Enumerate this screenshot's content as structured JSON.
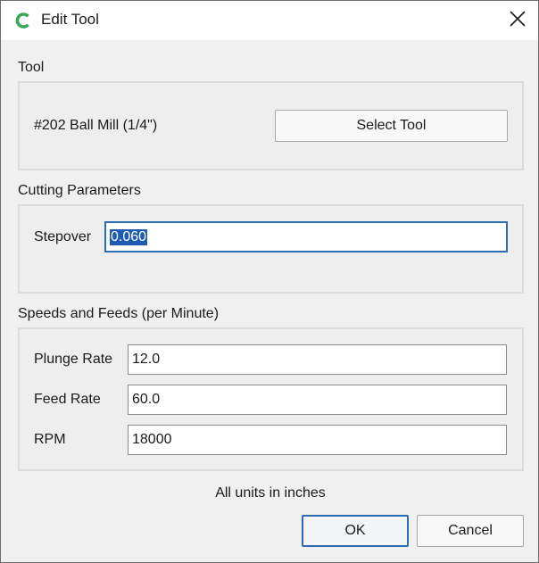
{
  "window": {
    "title": "Edit Tool",
    "app_icon": "green-c-logo-icon",
    "close_icon": "close-x-icon"
  },
  "tool_section": {
    "label": "Tool",
    "tool_name": "#202 Ball Mill (1/4\")",
    "select_button": "Select Tool"
  },
  "cutting_section": {
    "label": "Cutting Parameters",
    "stepover_label": "Stepover",
    "stepover_value": "0.060"
  },
  "speeds_section": {
    "label": "Speeds and Feeds (per Minute)",
    "plunge_label": "Plunge Rate",
    "plunge_value": "12.0",
    "feed_label": "Feed Rate",
    "feed_value": "60.0",
    "rpm_label": "RPM",
    "rpm_value": "18000"
  },
  "footer": {
    "units_note": "All units in inches",
    "ok_label": "OK",
    "cancel_label": "Cancel"
  },
  "colors": {
    "accent": "#2b6cb3",
    "selection": "#1e5cb3",
    "logo_green": "#3aa757"
  }
}
